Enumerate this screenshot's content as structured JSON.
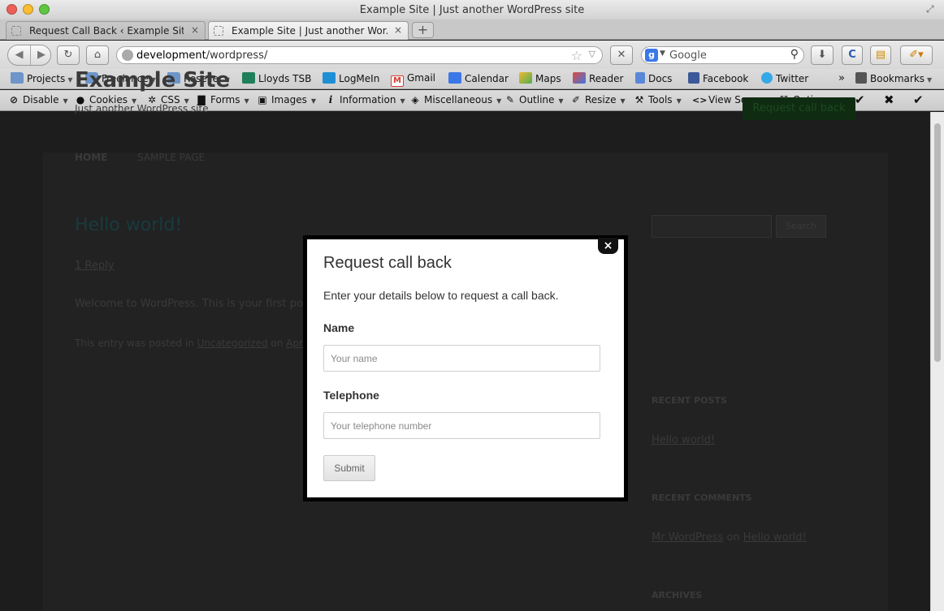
{
  "window": {
    "title": "Example Site | Just another WordPress site"
  },
  "tabs": [
    {
      "label": "Request Call Back ‹ Example Sit...",
      "close": "×"
    },
    {
      "label": "Example Site | Just another Wor...",
      "close": "×"
    }
  ],
  "newtab": "+",
  "nav": {
    "url_host": "development",
    "url_path": "/wordpress/",
    "search_engine": "g",
    "search_placeholder": "Google"
  },
  "bookmarks": [
    {
      "label": "Projects",
      "icon": "folder-icon",
      "color": "#6e95c9",
      "dropdown": true
    },
    {
      "label": "Freelance",
      "icon": "folder-icon",
      "color": "#6e95c9",
      "dropdown": true
    },
    {
      "label": "Reseller",
      "icon": "folder-icon",
      "color": "#6e95c9",
      "dropdown": true
    },
    {
      "label": "Lloyds TSB",
      "icon": "lloyds-icon",
      "color": "#1f7f5a",
      "dropdown": false
    },
    {
      "label": "LogMeIn",
      "icon": "logmein-icon",
      "color": "#1e8fd5",
      "dropdown": false
    },
    {
      "label": "Gmail",
      "icon": "gmail-icon",
      "color": "#d93b2f",
      "dropdown": false
    },
    {
      "label": "Calendar",
      "icon": "calendar-icon",
      "color": "#3b78e7",
      "dropdown": false
    },
    {
      "label": "Maps",
      "icon": "maps-icon",
      "color": "#f2b732",
      "dropdown": false
    },
    {
      "label": "Reader",
      "icon": "reader-icon",
      "color": "#e24a3b",
      "dropdown": false
    },
    {
      "label": "Docs",
      "icon": "docs-icon",
      "color": "#5a88d8",
      "dropdown": false
    },
    {
      "label": "Facebook",
      "icon": "facebook-icon",
      "color": "#3b5998",
      "dropdown": false
    },
    {
      "label": "Twitter",
      "icon": "twitter-icon",
      "color": "#35a9e8",
      "dropdown": false
    }
  ],
  "bookmarks_menu": "Bookmarks",
  "overflow": "»",
  "devbar": [
    {
      "label": "Disable",
      "glyph": "⊘",
      "icon": "disable-icon"
    },
    {
      "label": "Cookies",
      "glyph": "👤",
      "icon": "cookies-icon"
    },
    {
      "label": "CSS",
      "glyph": "✲",
      "icon": "css-icon"
    },
    {
      "label": "Forms",
      "glyph": "▇",
      "icon": "forms-icon"
    },
    {
      "label": "Images",
      "glyph": "▣",
      "icon": "images-icon"
    },
    {
      "label": "Information",
      "glyph": "i",
      "icon": "information-icon"
    },
    {
      "label": "Miscellaneous",
      "glyph": "◈",
      "icon": "miscellaneous-icon"
    },
    {
      "label": "Outline",
      "glyph": "✎",
      "icon": "outline-icon"
    },
    {
      "label": "Resize",
      "glyph": "✐",
      "icon": "resize-icon"
    },
    {
      "label": "Tools",
      "glyph": "⚒",
      "icon": "tools-icon"
    },
    {
      "label": "View Source",
      "glyph": "<>",
      "icon": "view-source-icon"
    },
    {
      "label": "Options",
      "glyph": "☷",
      "icon": "options-icon"
    }
  ],
  "devbar_checks": [
    "✔",
    "✖",
    "✔"
  ],
  "site": {
    "title": "Example Site",
    "description": "Just another WordPress site",
    "cta": "Request call back",
    "nav_home": "HOME",
    "nav_sample": "SAMPLE PAGE",
    "post_title": "Hello world!",
    "reply": "1 Reply",
    "post_body": "Welcome to WordPress. This is your first po",
    "meta_prefix": "This entry was posted in ",
    "meta_category": "Uncategorized",
    "meta_on": " on ",
    "meta_date": "Apr",
    "search_button": "Search",
    "recent_posts_heading": "RECENT POSTS",
    "recent_post": "Hello world!",
    "recent_comments_heading": "RECENT COMMENTS",
    "comment_author": "Mr WordPress",
    "comment_on": " on ",
    "comment_post": "Hello world!",
    "archives_heading": "ARCHIVES"
  },
  "modal": {
    "close": "×",
    "title": "Request call back",
    "description": "Enter your details below to request a call back.",
    "name_label": "Name",
    "name_placeholder": "Your name",
    "telephone_label": "Telephone",
    "telephone_placeholder": "Your telephone number",
    "submit": "Submit"
  }
}
